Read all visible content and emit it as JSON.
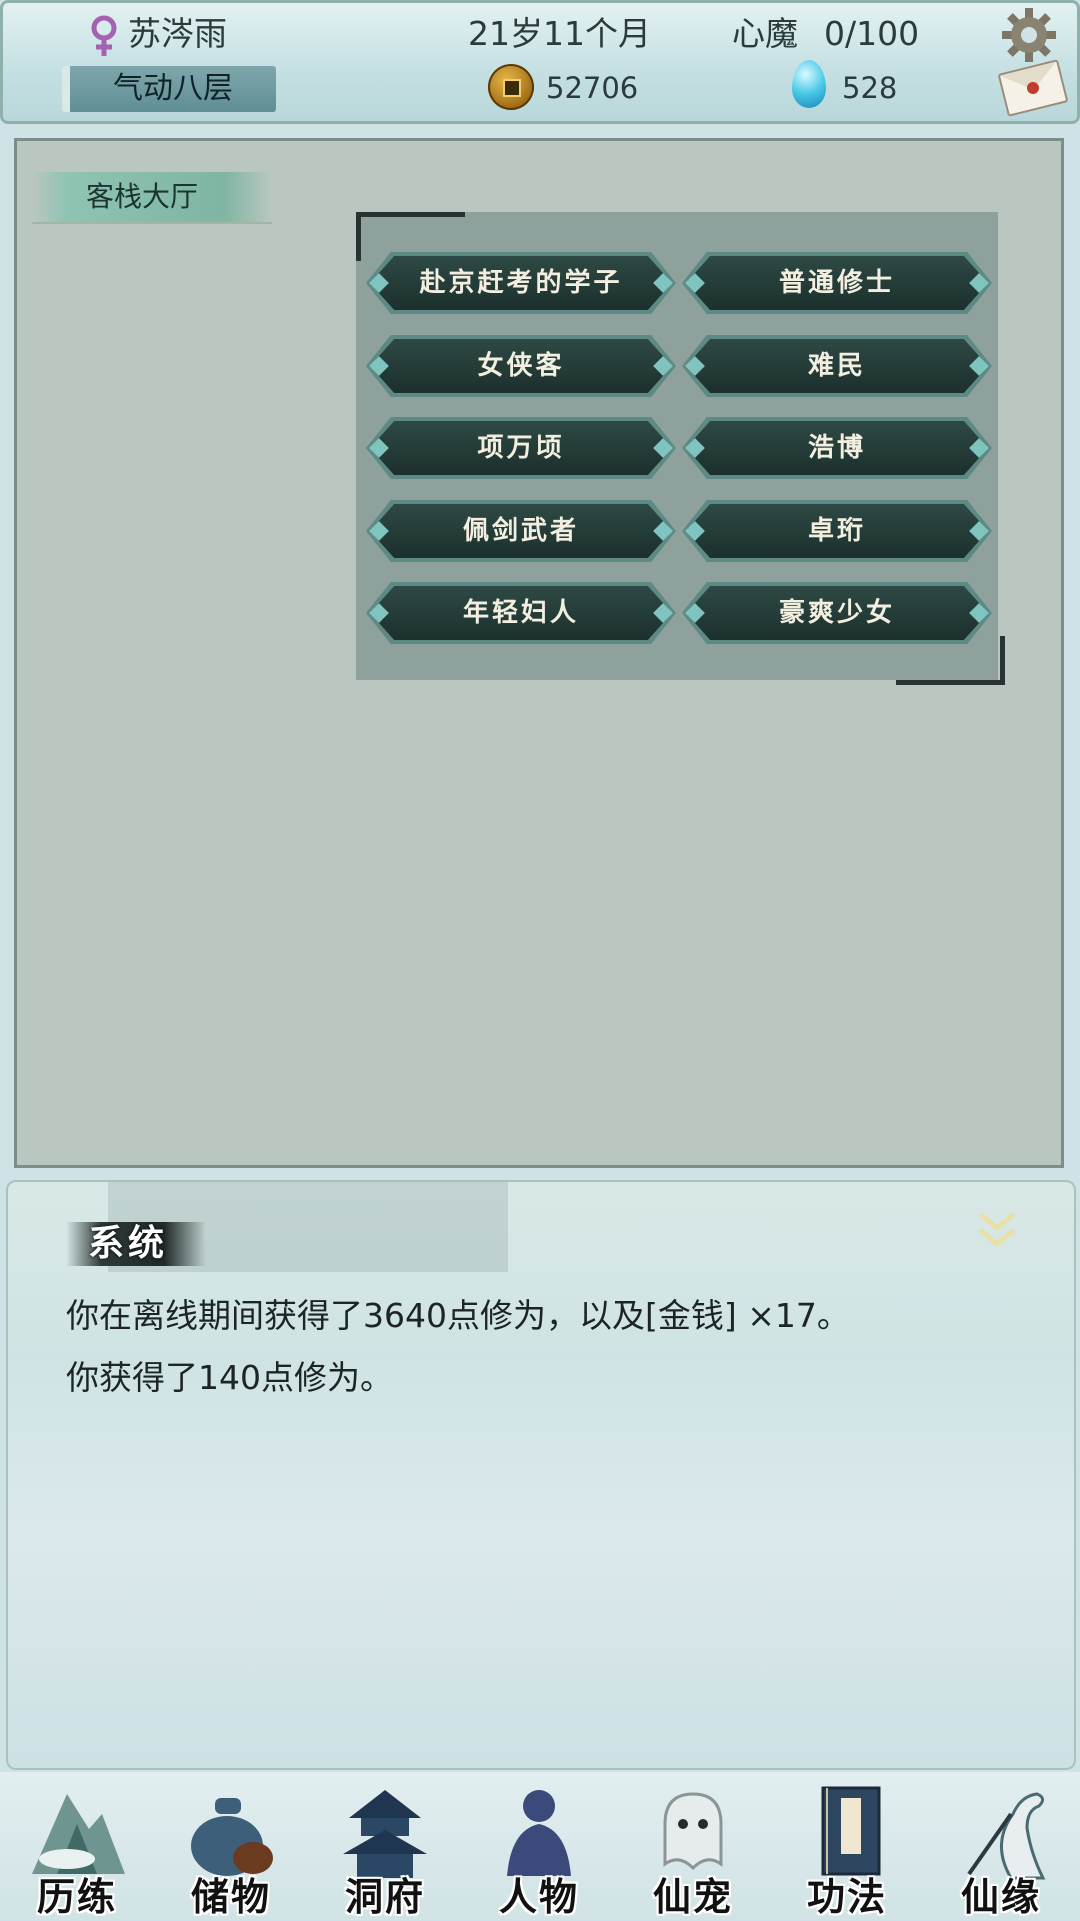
{
  "header": {
    "player_name": "苏涔雨",
    "realm": "气动八层",
    "age": "21岁11个月",
    "heart_demon_label": "心魔",
    "heart_demon_value": "0/100",
    "coins": "52706",
    "spirit_stones": "528",
    "icons": [
      "female-icon",
      "coin-icon",
      "spirit-stone-icon",
      "settings-icon",
      "mail-icon"
    ]
  },
  "location": {
    "name": "客栈大厅"
  },
  "npcs": [
    "赴京赶考的学子",
    "普通修士",
    "女侠客",
    "难民",
    "项万顷",
    "浩博",
    "佩剑武者",
    "卓珩",
    "年轻妇人",
    "豪爽少女"
  ],
  "log": {
    "title": "系统",
    "lines": [
      "你在离线期间获得了3640点修为，以及[金钱] ×17。",
      "你获得了140点修为。"
    ]
  },
  "nav": [
    {
      "label": "历练",
      "icon": "mountain-icon"
    },
    {
      "label": "储物",
      "icon": "storage-bag-icon"
    },
    {
      "label": "洞府",
      "icon": "pagoda-icon"
    },
    {
      "label": "人物",
      "icon": "character-icon"
    },
    {
      "label": "仙宠",
      "icon": "spirit-pet-icon"
    },
    {
      "label": "功法",
      "icon": "scroll-book-icon"
    },
    {
      "label": "仙缘",
      "icon": "crane-icon"
    }
  ],
  "colors": {
    "header_bg": "#c4dfe2",
    "panel_bg": "#b9c7c0",
    "npc_button": "#1e3532",
    "npc_text": "#f3efe0"
  }
}
